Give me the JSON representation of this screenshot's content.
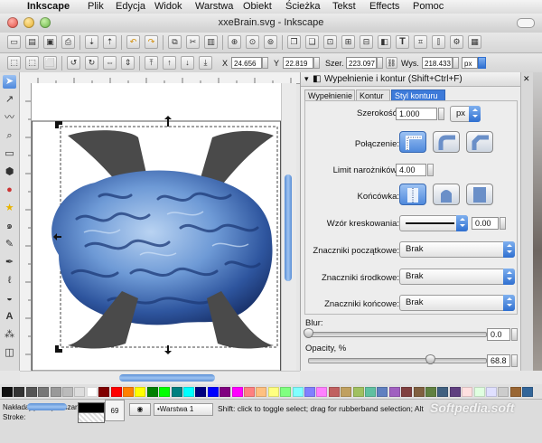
{
  "menubar": {
    "app_name": "Inkscape",
    "items": [
      "Plik",
      "Edycja",
      "Widok",
      "Warstwa",
      "Obiekt",
      "Ścieżka",
      "Tekst",
      "Effects",
      "Pomoc"
    ]
  },
  "window": {
    "title": "xxeBrain.svg - Inkscape"
  },
  "coords": {
    "x_label": "X",
    "x_value": "24.656",
    "y_label": "Y",
    "y_value": "22.819",
    "w_label": "Szer.",
    "w_value": "223.097",
    "h_label": "Wys.",
    "h_value": "218.433",
    "unit": "px"
  },
  "panel": {
    "title": "Wypełnienie i kontur (Shift+Ctrl+F)",
    "tabs": [
      "Wypełnienie",
      "Kontur",
      "Styl konturu"
    ],
    "active_tab": 2,
    "width_label": "Szerokość:",
    "width_value": "1.000",
    "width_unit": "px",
    "join_label": "Połączenie:",
    "miter_label": "Limit narożników:",
    "miter_value": "4.00",
    "cap_label": "Końcówka:",
    "dash_label": "Wzór kreskowania:",
    "dash_offset": "0.00",
    "markers": [
      {
        "label": "Znaczniki początkowe:",
        "value": "Brak"
      },
      {
        "label": "Znaczniki środkowe:",
        "value": "Brak"
      },
      {
        "label": "Znaczniki końcowe:",
        "value": "Brak"
      }
    ],
    "blur_label": "Blur:",
    "blur_value": "0.0",
    "blur_fraction": 0.0,
    "opacity_label": "Opacity, %",
    "opacity_value": "68.8",
    "opacity_fraction": 0.688
  },
  "statusbar": {
    "fill_label": "Nakładające się obszary:",
    "stroke_label": "Stroke:",
    "stroke_value": "69",
    "layer": "•Warstwa 1",
    "message": "Shift: click to toggle select; drag for rubberband selection; Alt",
    "watermark": "Softpedia.soft"
  },
  "colors": {
    "accent": "#3d7ad9",
    "glyph_gray": "#4a4a4a",
    "brain_blue": "#3f6cb0"
  },
  "palette": [
    "#111111",
    "#333333",
    "#555555",
    "#777777",
    "#999999",
    "#bbbbbb",
    "#dddddd",
    "#ffffff",
    "#800000",
    "#ff0000",
    "#ff8000",
    "#ffff00",
    "#008000",
    "#00ff00",
    "#008080",
    "#00ffff",
    "#000080",
    "#0000ff",
    "#800080",
    "#ff00ff",
    "#ff8080",
    "#ffc080",
    "#ffff80",
    "#80ff80",
    "#80ffff",
    "#8080ff",
    "#ff80ff",
    "#c06060",
    "#c0a060",
    "#a0c060",
    "#60c0a0",
    "#6080c0",
    "#a060c0",
    "#804040",
    "#806040",
    "#608040",
    "#406080",
    "#604080",
    "#ffe0e0",
    "#e0ffe0",
    "#e0e0ff",
    "#cccccc",
    "#996633",
    "#336699"
  ]
}
